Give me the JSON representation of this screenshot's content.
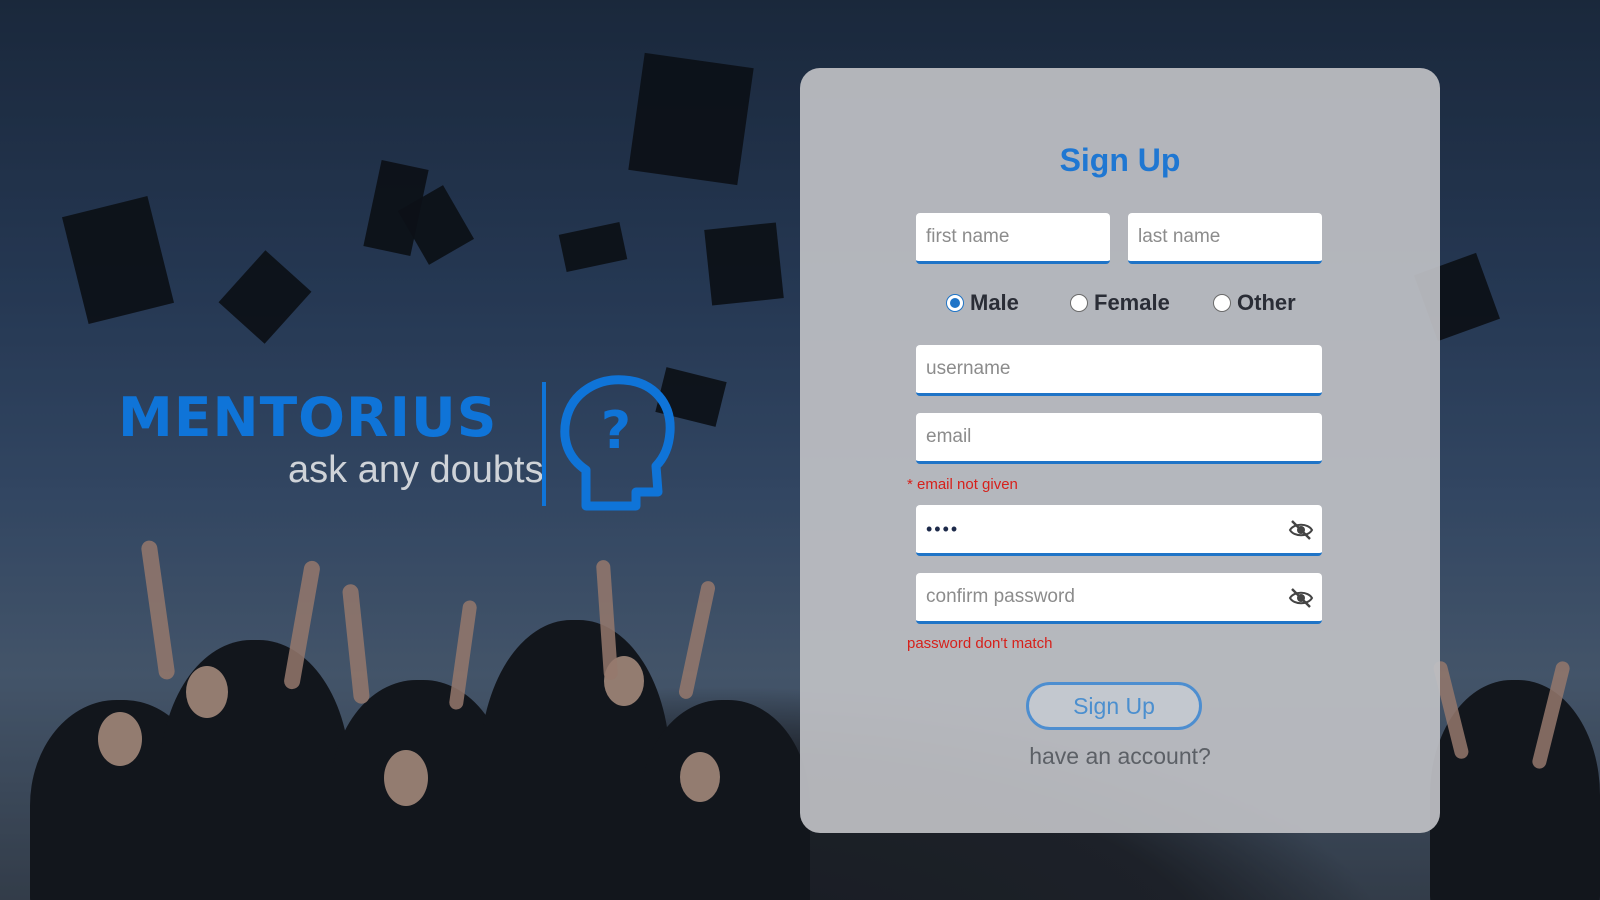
{
  "brand": {
    "name": "MENTORIUS",
    "tagline": "ask any doubts",
    "accent": "#0f74d8"
  },
  "form": {
    "title": "Sign Up",
    "first_name_placeholder": "first name",
    "last_name_placeholder": "last name",
    "gender_options": [
      {
        "label": "Male",
        "selected": true
      },
      {
        "label": "Female",
        "selected": false
      },
      {
        "label": "Other",
        "selected": false
      }
    ],
    "username_placeholder": "username",
    "email_placeholder": "email",
    "email_error": "* email not given",
    "password_value": "••••",
    "confirm_password_placeholder": "confirm password",
    "password_error": "password don't match",
    "submit_label": "Sign Up",
    "have_account_link": "have an account?",
    "error_color": "#d6211b",
    "title_color": "#1f77d2"
  }
}
